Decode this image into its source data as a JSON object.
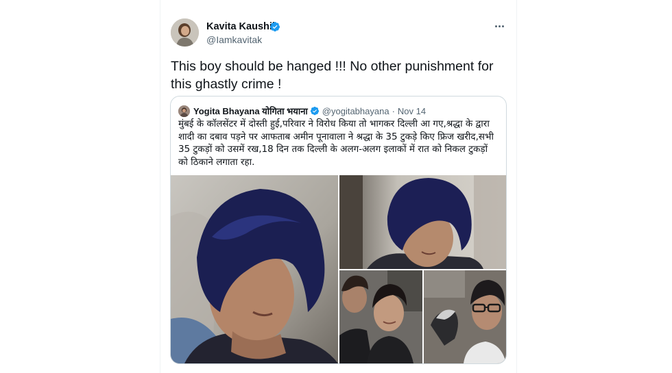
{
  "tweet": {
    "author": {
      "name": "Kavita Kaushik",
      "handle": "@Iamkavitak",
      "verified": true,
      "avatar": "profile-photo"
    },
    "text_line1": "This boy should be hanged !!! No other punishment for",
    "text_line2": "this ghastly crime !"
  },
  "quote": {
    "author": {
      "name": "Yogita Bhayana योगिता भयाना",
      "handle": "@yogitabhayana",
      "separator": "·",
      "date": "Nov 14",
      "verified": true
    },
    "text_lines": [
      "मुंबई के कॉलसेंटर में दोस्ती हुई,परिवार ने विरोध किया तो भागकर दिल्ली आ गए,श्रद्धा के द्वारा",
      "शादी का दबाव पड़ने पर आफताब अमीन पूनावाला ने श्रद्धा के 35 टुकड़े किए फ्रिज खरीद,सभी",
      "35 टुकड़ों को उसमें रख,18 दिन तक दिल्ली के अलग-अलग इलाकों में रात को निकल टुकड़ों",
      "को ठिकाने लगाता रहा."
    ],
    "media": [
      "portrait-photo",
      "portrait-photo",
      "couple-selfie-photo",
      "man-portrait-photo"
    ]
  },
  "colors": {
    "text": "#0f1419",
    "secondary": "#536471",
    "verified": "#1d9bf0",
    "border": "#cfd9de"
  },
  "icons": {
    "verified": "verified-badge-icon",
    "more": "more-options-icon"
  }
}
